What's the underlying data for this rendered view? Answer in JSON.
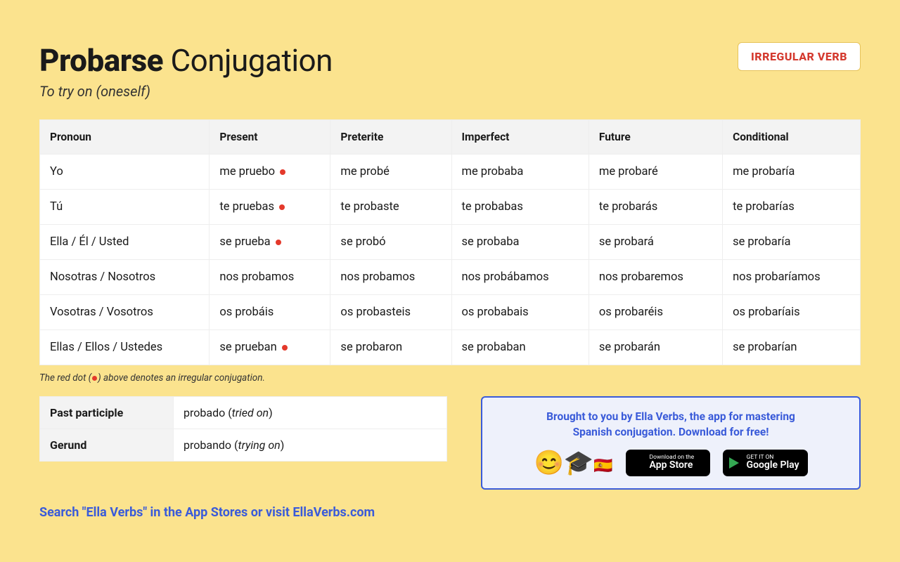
{
  "header": {
    "verb": "Probarse",
    "suffix": "Conjugation",
    "translation": "To try on (oneself)",
    "badge": "IRREGULAR VERB"
  },
  "columns": [
    "Pronoun",
    "Present",
    "Preterite",
    "Imperfect",
    "Future",
    "Conditional"
  ],
  "rows": [
    {
      "pronoun": "Yo",
      "present": "me pruebo",
      "present_irr": true,
      "preterite": "me probé",
      "imperfect": "me probaba",
      "future": "me probaré",
      "conditional": "me probaría"
    },
    {
      "pronoun": "Tú",
      "present": "te pruebas",
      "present_irr": true,
      "preterite": "te probaste",
      "imperfect": "te probabas",
      "future": "te probarás",
      "conditional": "te probarías"
    },
    {
      "pronoun": "Ella / Él / Usted",
      "present": "se prueba",
      "present_irr": true,
      "preterite": "se probó",
      "imperfect": "se probaba",
      "future": "se probará",
      "conditional": "se probaría"
    },
    {
      "pronoun": "Nosotras / Nosotros",
      "present": "nos probamos",
      "present_irr": false,
      "preterite": "nos probamos",
      "imperfect": "nos probábamos",
      "future": "nos probaremos",
      "conditional": "nos probaríamos"
    },
    {
      "pronoun": "Vosotras / Vosotros",
      "present": "os probáis",
      "present_irr": false,
      "preterite": "os probasteis",
      "imperfect": "os probabais",
      "future": "os probaréis",
      "conditional": "os probaríais"
    },
    {
      "pronoun": "Ellas / Ellos / Ustedes",
      "present": "se prueban",
      "present_irr": true,
      "preterite": "se probaron",
      "imperfect": "se probaban",
      "future": "se probarán",
      "conditional": "se probarían"
    }
  ],
  "note_pre": "The red dot (",
  "note_post": ") above denotes an irregular conjugation.",
  "forms": {
    "pp_label": "Past participle",
    "pp_value": "probado",
    "pp_gloss": "tried on",
    "ger_label": "Gerund",
    "ger_value": "probando",
    "ger_gloss": "trying on"
  },
  "promo": {
    "line1": "Brought to you by Ella Verbs, the app for mastering",
    "line2": "Spanish conjugation. Download for free!",
    "appstore_small": "Download on the",
    "appstore_big": "App Store",
    "gplay_small": "GET IT ON",
    "gplay_big": "Google Play"
  },
  "search_line": "Search \"Ella Verbs\" in the App Stores or visit EllaVerbs.com"
}
